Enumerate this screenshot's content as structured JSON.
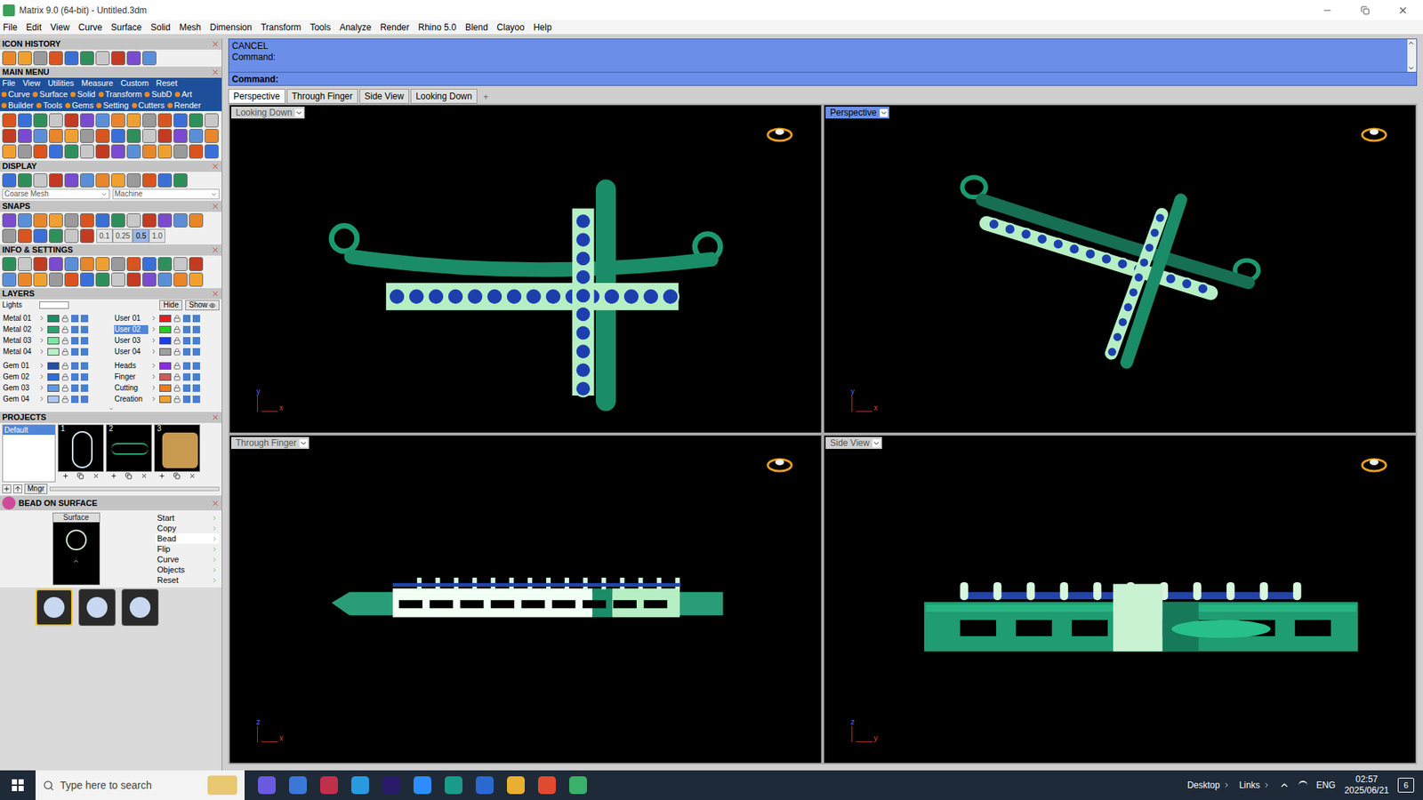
{
  "window": {
    "title": "Matrix 9.0 (64-bit) - Untitled.3dm"
  },
  "menu_bar": [
    "File",
    "Edit",
    "View",
    "Curve",
    "Surface",
    "Solid",
    "Mesh",
    "Dimension",
    "Transform",
    "Tools",
    "Analyze",
    "Render",
    "Rhino 5.0",
    "Blend",
    "Clayoo",
    "Help"
  ],
  "panels": {
    "icon_history": {
      "title": "ICON HISTORY"
    },
    "main_menu": {
      "title": "MAIN MENU",
      "menu": [
        "File",
        "View",
        "Utilities",
        "Measure",
        "Custom",
        "Reset"
      ],
      "categories": [
        "Curve",
        "Surface",
        "Solid",
        "Transform",
        "SubD",
        "Art",
        "Builder",
        "Tools",
        "Gems",
        "Setting",
        "Cutters",
        "Render"
      ]
    },
    "display": {
      "title": "DISPLAY",
      "mesh": "Coarse Mesh",
      "material": "Machine"
    },
    "snaps": {
      "title": "SNAPS",
      "steps": [
        {
          "label": "0.1",
          "selected": false
        },
        {
          "label": "0.25",
          "selected": false
        },
        {
          "label": "0.5",
          "selected": true
        },
        {
          "label": "1.0",
          "selected": false
        }
      ]
    },
    "info_settings": {
      "title": "INFO & SETTINGS"
    },
    "layers": {
      "title": "LAYERS",
      "lights": "Lights",
      "hide": "Hide",
      "show": "Show",
      "blocks": [
        [
          {
            "name": "Metal 01",
            "color": "#1b8c68",
            "selected": false
          },
          {
            "name": "User 01",
            "color": "#e02020",
            "selected": false
          },
          {
            "name": "Metal 02",
            "color": "#2aa56e",
            "selected": false
          },
          {
            "name": "User 02",
            "color": "#22cc22",
            "selected": true
          },
          {
            "name": "Metal 03",
            "color": "#7ee6a0",
            "selected": false
          },
          {
            "name": "User 03",
            "color": "#1a3ee6",
            "selected": false
          },
          {
            "name": "Metal 04",
            "color": "#b8f0c8",
            "selected": false
          },
          {
            "name": "User 04",
            "color": "#a0a0a0",
            "selected": false
          }
        ],
        [
          {
            "name": "Gem 01",
            "color": "#1f4fa8",
            "selected": false
          },
          {
            "name": "Heads",
            "color": "#8a2be2",
            "selected": false
          },
          {
            "name": "Gem 02",
            "color": "#2a6ee0",
            "selected": false
          },
          {
            "name": "Finger",
            "color": "#d05a5a",
            "selected": false
          },
          {
            "name": "Gem 03",
            "color": "#5b9ae8",
            "selected": false
          },
          {
            "name": "Cutting",
            "color": "#f07a1a",
            "selected": false
          },
          {
            "name": "Gem 04",
            "color": "#a8c8f0",
            "selected": false
          },
          {
            "name": "Creation",
            "color": "#f0a030",
            "selected": false
          }
        ]
      ]
    },
    "projects": {
      "title": "PROJECTS",
      "list": [
        {
          "label": "Default",
          "selected": true
        }
      ],
      "thumbnails": [
        "1",
        "2",
        "3"
      ],
      "manager": "Mngr"
    },
    "bead_on_surface": {
      "title": "BEAD ON SURFACE",
      "preview": "Surface",
      "options": [
        {
          "label": "Start",
          "selected": false
        },
        {
          "label": "Copy",
          "selected": false
        },
        {
          "label": "Bead",
          "selected": true
        },
        {
          "label": "Flip",
          "selected": false
        },
        {
          "label": "Curve",
          "selected": false
        },
        {
          "label": "Objects",
          "selected": false
        },
        {
          "label": "Reset",
          "selected": false
        }
      ]
    }
  },
  "command": {
    "history": [
      "CANCEL",
      "Command:"
    ],
    "prompt": "Command:",
    "value": ""
  },
  "view_tabs": [
    {
      "label": "Perspective",
      "selected": true
    },
    {
      "label": "Through Finger",
      "selected": false
    },
    {
      "label": "Side View",
      "selected": false
    },
    {
      "label": "Looking Down",
      "selected": false
    }
  ],
  "add_tab": "+",
  "viewports": [
    {
      "label": "Looking Down",
      "active": false,
      "axes": [
        "y",
        "x"
      ],
      "view": "top"
    },
    {
      "label": "Perspective",
      "active": true,
      "axes": [
        "y",
        "x"
      ],
      "view": "perspective"
    },
    {
      "label": "Through Finger",
      "active": false,
      "axes": [
        "z",
        "x"
      ],
      "view": "front"
    },
    {
      "label": "Side View",
      "active": false,
      "axes": [
        "z",
        "y"
      ],
      "view": "side"
    }
  ],
  "taskbar": {
    "search": "Type here to search",
    "items": [
      "Desktop",
      "Links"
    ],
    "language": "ENG",
    "time": "02:57",
    "date": "2025/06/21",
    "notifications": "6"
  }
}
